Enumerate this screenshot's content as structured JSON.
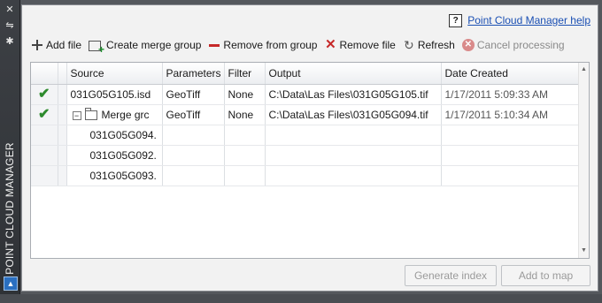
{
  "sidebar": {
    "title": "POINT CLOUD MANAGER",
    "close_glyph": "✕",
    "pin_glyph": "⇋",
    "settings_glyph": "✱"
  },
  "help": {
    "icon_glyph": "?",
    "link_text": "Point Cloud Manager help"
  },
  "toolbar": {
    "add_file": "Add file",
    "create_merge_group": "Create merge group",
    "remove_from_group": "Remove from group",
    "remove_file": "Remove file",
    "refresh": "Refresh",
    "cancel_processing": "Cancel processing"
  },
  "table": {
    "headers": {
      "source": "Source",
      "parameters": "Parameters",
      "filter": "Filter",
      "output": "Output",
      "date_created": "Date Created"
    },
    "rows": [
      {
        "status": "✔",
        "source": "031G05G105.isd",
        "parameters": "GeoTiff",
        "filter": "None",
        "output": "C:\\Data\\Las Files\\031G05G105.tif",
        "date": "1/17/2011 5:09:33 AM"
      },
      {
        "status": "✔",
        "expander": "−",
        "source": "Merge grc",
        "parameters": "GeoTiff",
        "filter": "None",
        "output": "C:\\Data\\Las Files\\031G05G094.tif",
        "date": "1/17/2011 5:10:34 AM"
      },
      {
        "source": "031G05G094."
      },
      {
        "source": "031G05G092."
      },
      {
        "source": "031G05G093."
      }
    ]
  },
  "buttons": {
    "generate_index": "Generate index",
    "add_to_map": "Add to map"
  },
  "colors": {
    "success": "#2e8b2e",
    "danger": "#c62828",
    "link": "#1a4fb3"
  }
}
